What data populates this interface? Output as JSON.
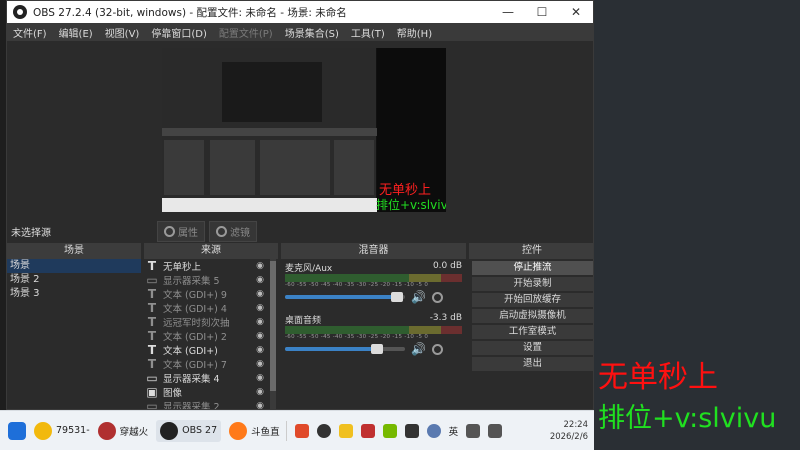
{
  "window": {
    "title": "OBS 27.2.4 (32-bit, windows) - 配置文件: 未命名 - 场景: 未命名",
    "minimize": "—",
    "maximize": "☐",
    "close": "✕"
  },
  "menu": [
    "文件(F)",
    "编辑(E)",
    "视图(V)",
    "停靠窗口(D)",
    "配置文件(P)",
    "场景集合(S)",
    "工具(T)",
    "帮助(H)"
  ],
  "preview": {
    "overlay_line1": "无单秒上",
    "overlay_line2": "排位+v:slvivu"
  },
  "source_bar": {
    "no_selection": "未选择源",
    "properties": "属性",
    "filters": "滤镜"
  },
  "scenes": {
    "header": "场景",
    "items": [
      "场景",
      "场景 2",
      "场景 3"
    ]
  },
  "sources": {
    "header": "来源",
    "items": [
      {
        "type": "T",
        "label": "无单秒上",
        "dim": false
      },
      {
        "type": "▭",
        "label": "显示器采集 5",
        "dim": true
      },
      {
        "type": "T",
        "label": "文本 (GDI+) 9",
        "dim": true
      },
      {
        "type": "T",
        "label": "文本 (GDI+) 4",
        "dim": true
      },
      {
        "type": "T",
        "label": "远冠军时刻次抽",
        "dim": true
      },
      {
        "type": "T",
        "label": "文本 (GDI+) 2",
        "dim": true
      },
      {
        "type": "T",
        "label": "文本 (GDI+)",
        "dim": false
      },
      {
        "type": "T",
        "label": "文本 (GDI+) 7",
        "dim": true
      },
      {
        "type": "▭",
        "label": "显示器采集 4",
        "dim": false
      },
      {
        "type": "▣",
        "label": "图像",
        "dim": false
      },
      {
        "type": "▭",
        "label": "显示器采集 2",
        "dim": true
      }
    ]
  },
  "mixer": {
    "header": "混音器",
    "ticks": "-60 -55 -50 -45 -40 -35 -30 -25 -20 -15 -10 -5 0",
    "tracks": [
      {
        "name": "麦克风/Aux",
        "db": "0.0 dB",
        "volume": 0.93
      },
      {
        "name": "桌面音频",
        "db": "-3.3 dB",
        "volume": 0.77
      }
    ]
  },
  "controls": {
    "header": "控件",
    "buttons": [
      "停止推流",
      "开始录制",
      "开始回放缓存",
      "启动虚拟摄像机",
      "工作室模式",
      "设置",
      "退出"
    ]
  },
  "taskbar": {
    "items": [
      {
        "label": "",
        "color": "#1e6fd9"
      },
      {
        "label": "79531-",
        "color": "#f2b90d"
      },
      {
        "label": "穿越火",
        "color": "#b03030"
      },
      {
        "label": "OBS 27",
        "color": "#222222"
      },
      {
        "label": "斗鱼直",
        "color": "#ff7a1a"
      }
    ],
    "tray": [
      "英"
    ],
    "time": "22:24",
    "date": "2026/2/6"
  },
  "overlay": {
    "line1": "无单秒上",
    "line2": "排位+v:slvivu"
  }
}
